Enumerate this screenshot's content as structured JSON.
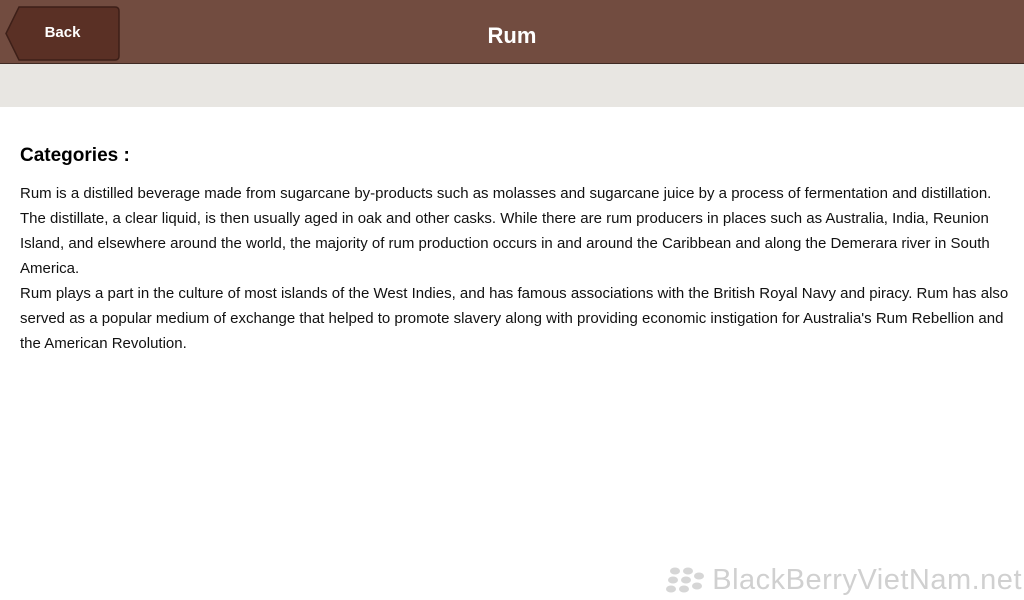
{
  "header": {
    "back_label": "Back",
    "title": "Rum"
  },
  "content": {
    "heading": "Categories :",
    "paragraph_1": "Rum is a distilled beverage made from sugarcane by-products such as molasses and sugarcane juice by a process of fermentation and distillation. The distillate, a clear liquid, is then usually aged in oak and other casks. While there are rum producers in places such as Australia, India, Reunion Island, and elsewhere around the world, the majority of rum production occurs in and around the Caribbean and along the Demerara river in South America.",
    "paragraph_2": "Rum plays a part in the culture of most islands of the West Indies, and has famous associations with the British Royal Navy and piracy. Rum has also served as a popular medium of exchange that helped to promote slavery along with providing economic instigation for Australia's Rum Rebellion and the American Revolution."
  },
  "watermark": {
    "text": "BlackBerryVietNam.net",
    "icon": "blackberry-logo-icon"
  },
  "colors": {
    "titlebar": "#724c40",
    "back_button": "#5a3025",
    "subbar": "#e8e6e2",
    "watermark": "#d0d0d0"
  }
}
